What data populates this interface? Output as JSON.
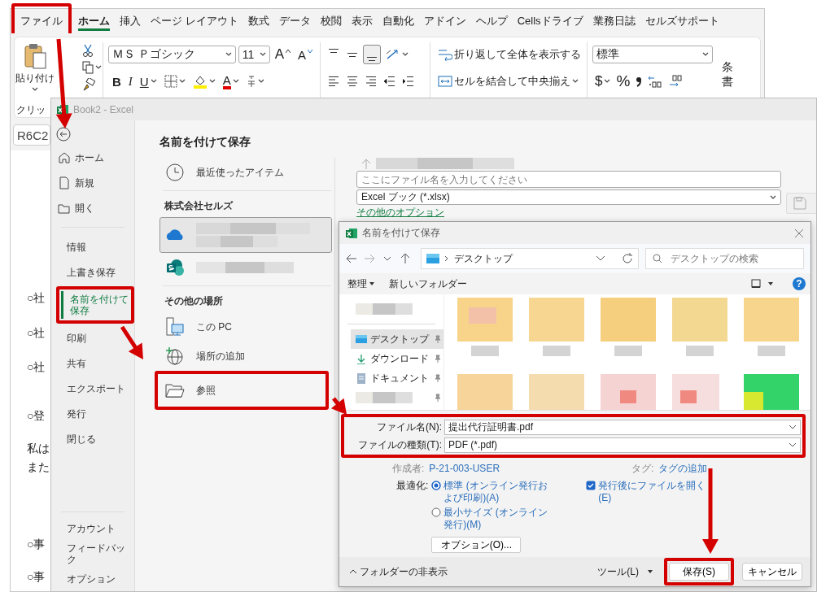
{
  "excel": {
    "tabs": [
      {
        "label": "ファイル",
        "selected": false
      },
      {
        "label": "ホーム",
        "selected": true
      },
      {
        "label": "挿入",
        "selected": false
      },
      {
        "label": "ページ レイアウト",
        "selected": false
      },
      {
        "label": "数式",
        "selected": false
      },
      {
        "label": "データ",
        "selected": false
      },
      {
        "label": "校閲",
        "selected": false
      },
      {
        "label": "表示",
        "selected": false
      },
      {
        "label": "自動化",
        "selected": false
      },
      {
        "label": "アドイン",
        "selected": false
      },
      {
        "label": "ヘルプ",
        "selected": false
      },
      {
        "label": "Cellsドライブ",
        "selected": false
      },
      {
        "label": "業務日誌",
        "selected": false
      },
      {
        "label": "セルズサポート",
        "selected": false
      }
    ],
    "ribbon": {
      "paste": "貼り付け",
      "clipboard_group": "クリッ",
      "font_name": "ＭＳ Ｐゴシック",
      "font_size": "11",
      "grow_font": "A",
      "shrink_font": "A",
      "bold": "B",
      "italic": "I",
      "underline": "U",
      "font_color": "A",
      "vertical_align": [
        {
          "selected": false
        },
        {
          "selected": false
        },
        {
          "selected": true
        }
      ],
      "wrap_text": "折り返して全体を表示する",
      "merge": "セルを結合して中央揃え",
      "number_format": "標準",
      "currency": "$",
      "percent": "%",
      "cut_label": [
        "条",
        "書"
      ]
    },
    "name_box": "R6C2",
    "sheet_lines": [
      "○社",
      "○社",
      "○社",
      "○登",
      "私は",
      "また",
      "○事",
      "○事"
    ]
  },
  "backstage": {
    "title": "Book2 - Excel",
    "nav_top": [
      {
        "label": "ホーム",
        "selected": false
      },
      {
        "label": "新規",
        "selected": false
      },
      {
        "label": "開く",
        "selected": false
      }
    ],
    "nav_main": [
      {
        "label": "情報",
        "selected": false
      },
      {
        "label": "上書き保存",
        "selected": false
      },
      {
        "label": "名前を付けて保存",
        "selected": true
      },
      {
        "label": "印刷",
        "selected": false
      },
      {
        "label": "共有",
        "selected": false
      },
      {
        "label": "エクスポート",
        "selected": false
      },
      {
        "label": "発行",
        "selected": false
      },
      {
        "label": "閉じる",
        "selected": false
      }
    ],
    "nav_bottom": [
      {
        "label": "アカウント",
        "selected": false
      },
      {
        "label": "フィードバック",
        "selected": false
      },
      {
        "label": "オプション",
        "selected": false
      }
    ],
    "heading": "名前を付けて保存",
    "locations": [
      {
        "kind": "recent",
        "label": "最近使ったアイテム",
        "selected": false
      },
      {
        "kind": "section",
        "label": "株式会社セルズ"
      },
      {
        "kind": "cloud",
        "selected": true
      },
      {
        "kind": "site",
        "selected": false
      },
      {
        "kind": "section",
        "label": "その他の場所"
      },
      {
        "kind": "pc",
        "label": "この PC",
        "selected": false
      },
      {
        "kind": "add",
        "label": "場所の追加",
        "selected": false
      },
      {
        "kind": "browse",
        "label": "参照",
        "selected": false
      }
    ],
    "file_name": {
      "placeholder": "ここにファイル名を入力してください"
    },
    "file_type": "Excel ブック (*.xlsx)",
    "more_options": "その他のオプション"
  },
  "dialog": {
    "title": "名前を付けて保存",
    "path": "デスクトップ",
    "search": {
      "placeholder": "デスクトップの検索"
    },
    "toolbar": {
      "organize": "整理",
      "new_folder": "新しいフォルダー",
      "help": "?"
    },
    "sidebar": [
      {
        "kind": "blurred",
        "selected": false
      },
      {
        "kind": "desktop",
        "label": "デスクトップ",
        "selected": true
      },
      {
        "kind": "download",
        "label": "ダウンロード",
        "selected": false
      },
      {
        "kind": "documents",
        "label": "ドキュメント",
        "selected": false
      },
      {
        "kind": "blurred",
        "selected": false
      }
    ],
    "file_name": {
      "label": "ファイル名(N):",
      "value": "提出代行証明書.pdf"
    },
    "file_type": {
      "label": "ファイルの種類(T):",
      "value": "PDF (*.pdf)"
    },
    "author": {
      "label": "作成者:",
      "value": "P-21-003-USER"
    },
    "tags": {
      "label": "タグ:",
      "value": "タグの追加"
    },
    "optimize": {
      "label": "最適化:",
      "options": [
        {
          "label": "標準 (オンライン発行および印刷)(A)",
          "selected": true
        },
        {
          "label": "最小サイズ (オンライン発行)(M)",
          "selected": false
        }
      ]
    },
    "open_after": {
      "label": "発行後にファイルを開く(E)",
      "checked": true
    },
    "options_button": "オプション(O)...",
    "hide_folders": "フォルダーの非表示",
    "tools": "ツール(L)",
    "save": "保存(S)",
    "cancel": "キャンセル"
  }
}
